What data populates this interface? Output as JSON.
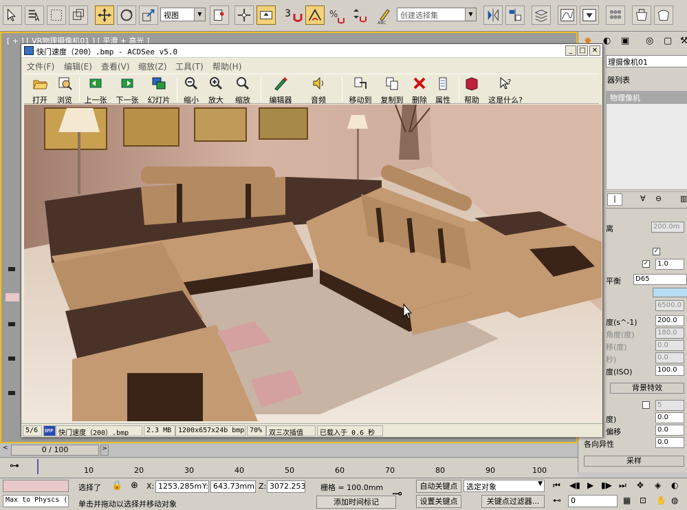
{
  "max_toolbar": {
    "view_dropdown": "视图",
    "selection_set_placeholder": "创建选择集",
    "snap_number": "3"
  },
  "viewport": {
    "label": "[ + ] [ VR物理摄像机01 ] [ 平滑 + 高光 ]"
  },
  "command_panel": {
    "camera_name": "理摄像机01",
    "modifier_list": "器列表",
    "stack_item": "物理像机",
    "distance_label": "离",
    "distance_value": "200.0m",
    "vignette_value": "1.0",
    "wb_label": "平衡",
    "wb_value": "D65",
    "temp_value": "6500.0",
    "shutter_label": "度(s^-1)",
    "shutter_value": "200.0",
    "angle_label": "角度(度)",
    "angle_value": "180.0",
    "offset_label": "移(度)",
    "offset_value": "0.0",
    "latency_label": "秒)",
    "latency_value": "0.0",
    "iso_label": "度(ISO)",
    "iso_value": "100.0",
    "bg_section": "背景特效",
    "blades_value": "5",
    "rotation_label": "度)",
    "rotation_value": "0.0",
    "center_label": "偏移",
    "center_value": "0.0",
    "aniso_label": "各向异性",
    "aniso_value": "0.0",
    "sampling_section": "采样"
  },
  "acdsee": {
    "title": "快门速度（200）.bmp - ACDSee v5.0",
    "menu": [
      "文件(F)",
      "编辑(E)",
      "查看(V)",
      "缩放(Z)",
      "工具(T)",
      "帮助(H)"
    ],
    "tools": [
      "打开",
      "浏览",
      "上一张",
      "下一张",
      "幻灯片",
      "缩小",
      "放大",
      "缩放",
      "编辑器",
      "音频",
      "移动到",
      "复制到",
      "删除",
      "属性",
      "帮助",
      "这是什么?"
    ],
    "status": {
      "index": "5/6",
      "format": "BMP",
      "filename": "快门速度（200）.bmp",
      "size": "2.3 MB",
      "dimensions": "1200x657x24b bmp",
      "zoom": "70%",
      "interp": "双三次插值",
      "loaded": "已载入于 0.6 秒"
    }
  },
  "timeline": {
    "frame": "0 / 100",
    "ticks": [
      "10",
      "20",
      "30",
      "40",
      "50",
      "60",
      "70",
      "80",
      "90",
      "100"
    ]
  },
  "status_bar": {
    "script_listener": "Max to Physcs (",
    "selected": "选择了",
    "x_label": "X:",
    "x_value": "1253.285m",
    "y_label": "Y:",
    "y_value": "643.73mm",
    "z_label": "Z:",
    "z_value": "3072.253m",
    "grid": "栅格 = 100.0mm",
    "prompt": "单击并拖动以选择并移动对象",
    "add_time_tag": "添加时间标记",
    "auto_key": "自动关键点",
    "set_key": "设置关键点",
    "key_target": "选定对象",
    "key_filters": "关键点过滤器...",
    "frame_value": "0"
  }
}
